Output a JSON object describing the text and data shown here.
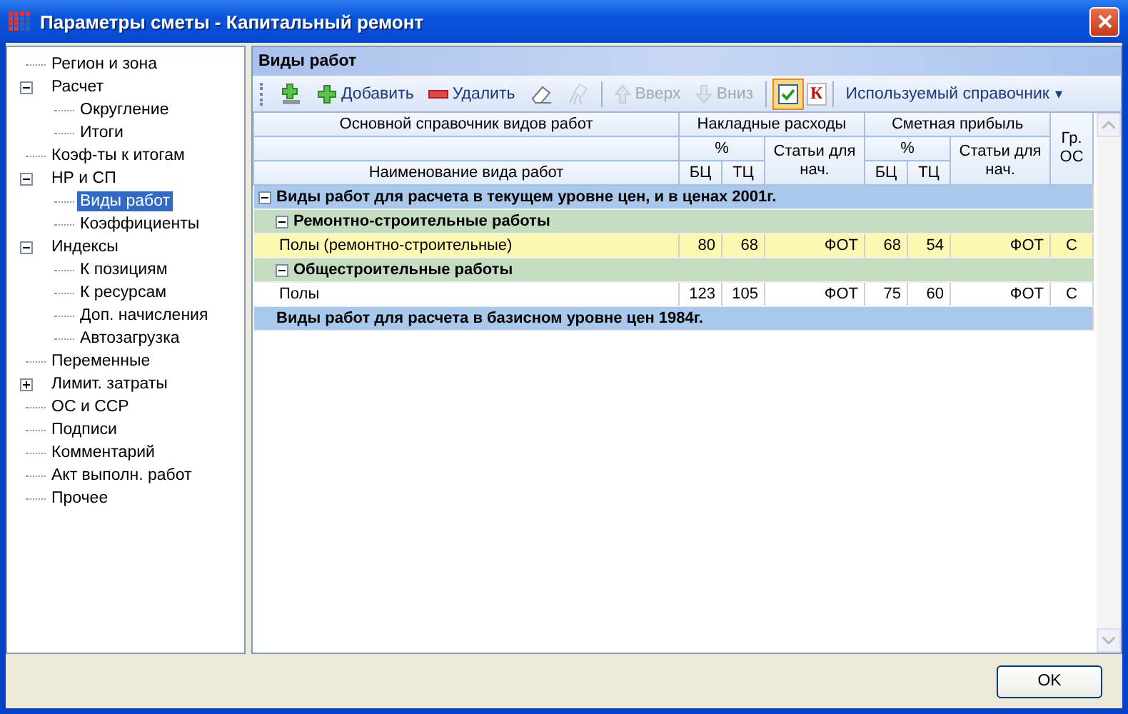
{
  "window": {
    "title": "Параметры сметы - Капитальный ремонт"
  },
  "sidebar": {
    "items": [
      {
        "label": "Регион и зона",
        "selected": false
      },
      {
        "label": "Расчет",
        "selected": false,
        "expanded": true,
        "children": [
          {
            "label": "Округление",
            "selected": false
          },
          {
            "label": "Итоги",
            "selected": false
          }
        ]
      },
      {
        "label": "Коэф-ты к итогам",
        "selected": false
      },
      {
        "label": "НР и СП",
        "selected": false,
        "expanded": true,
        "children": [
          {
            "label": "Виды работ",
            "selected": true
          },
          {
            "label": "Коэффициенты",
            "selected": false
          }
        ]
      },
      {
        "label": "Индексы",
        "selected": false,
        "expanded": true,
        "children": [
          {
            "label": "К позициям",
            "selected": false
          },
          {
            "label": "К ресурсам",
            "selected": false
          },
          {
            "label": "Доп. начисления",
            "selected": false
          },
          {
            "label": "Автозагрузка",
            "selected": false
          }
        ]
      },
      {
        "label": "Переменные",
        "selected": false
      },
      {
        "label": "Лимит. затраты",
        "selected": false,
        "expanded": false
      },
      {
        "label": "ОС и ССР",
        "selected": false
      },
      {
        "label": "Подписи",
        "selected": false
      },
      {
        "label": "Комментарий",
        "selected": false
      },
      {
        "label": "Акт выполн. работ",
        "selected": false
      },
      {
        "label": "Прочее",
        "selected": false
      }
    ]
  },
  "panel": {
    "title": "Виды работ"
  },
  "toolbar": [
    {
      "kind": "insert",
      "disabled": false
    },
    {
      "kind": "add",
      "label": "Добавить",
      "disabled": false
    },
    {
      "kind": "delete",
      "label": "Удалить",
      "disabled": false
    },
    {
      "kind": "erase",
      "disabled": false
    },
    {
      "kind": "clear",
      "disabled": true
    },
    {
      "kind": "separator"
    },
    {
      "kind": "up",
      "label": "Вверх",
      "disabled": true
    },
    {
      "kind": "down",
      "label": "Вниз",
      "disabled": true
    },
    {
      "kind": "separator"
    },
    {
      "kind": "toggle",
      "checked": true
    },
    {
      "kind": "letter",
      "label": "К"
    },
    {
      "kind": "separator"
    },
    {
      "kind": "dropdown",
      "label": "Используемый справочник",
      "caret": "▾"
    }
  ],
  "table": {
    "header": {
      "main": "Основной справочник видов работ",
      "name": "Наименование вида работ",
      "overhead": "Накладные расходы",
      "profit": "Сметная прибыль",
      "percent_1": "%",
      "percent_2": "%",
      "items_1": "Статьи для нач.",
      "items_2": "Статьи для нач.",
      "bc_1": "БЦ",
      "tc_1": "ТЦ",
      "bc_2": "БЦ",
      "tc_2": "ТЦ",
      "group": "Гр. ОС"
    },
    "groups": [
      {
        "label": "Виды работ для расчета в текущем уровне цен, и в ценах 2001г.",
        "expanded": true,
        "children": [
          {
            "label": "Ремонтно-строительные работы",
            "expanded": true,
            "rows": [
              {
                "name": "Полы (ремонтно-строительные)",
                "selected": true,
                "cells": [
                  "80",
                  "68",
                  "ФОТ",
                  "68",
                  "54",
                  "ФОТ",
                  "С"
                ]
              }
            ]
          },
          {
            "label": "Общестроительные работы",
            "expanded": true,
            "rows": [
              {
                "name": "Полы",
                "selected": false,
                "cells": [
                  "123",
                  "105",
                  "ФОТ",
                  "75",
                  "60",
                  "ФОТ",
                  "С"
                ]
              }
            ]
          }
        ]
      },
      {
        "label": "Виды работ для расчета в базисном уровне цен 1984г."
      }
    ]
  },
  "buttons": [
    {
      "label": "OK"
    }
  ]
}
